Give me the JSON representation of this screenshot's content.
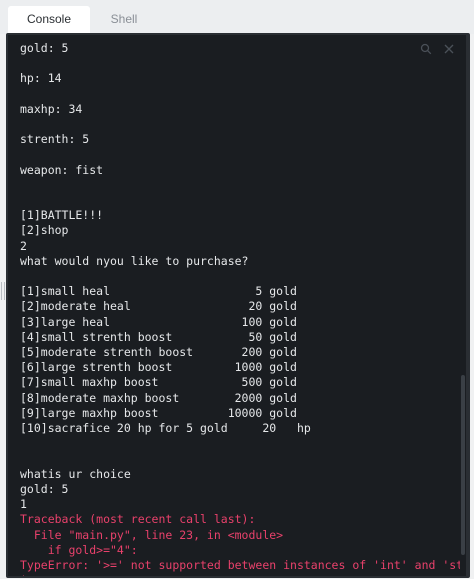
{
  "tabs": [
    {
      "label": "Console",
      "active": true
    },
    {
      "label": "Shell",
      "active": false
    }
  ],
  "toolbar": {
    "search_icon": "search-icon",
    "clear_icon": "close-icon"
  },
  "console": {
    "lines": [
      {
        "text": "gold: 5",
        "type": "out"
      },
      {
        "text": "",
        "type": "out"
      },
      {
        "text": "hp: 14",
        "type": "out"
      },
      {
        "text": "",
        "type": "out"
      },
      {
        "text": "maxhp: 34",
        "type": "out"
      },
      {
        "text": "",
        "type": "out"
      },
      {
        "text": "strenth: 5",
        "type": "out"
      },
      {
        "text": "",
        "type": "out"
      },
      {
        "text": "weapon: fist",
        "type": "out"
      },
      {
        "text": "",
        "type": "out"
      },
      {
        "text": "",
        "type": "out"
      },
      {
        "text": "[1]BATTLE!!!",
        "type": "out"
      },
      {
        "text": "[2]shop",
        "type": "out"
      },
      {
        "text": "2",
        "type": "out"
      },
      {
        "text": "what would nyou like to purchase?",
        "type": "out"
      },
      {
        "text": "",
        "type": "out"
      },
      {
        "text": "[1]small heal                     5 gold",
        "type": "out"
      },
      {
        "text": "[2]moderate heal                 20 gold",
        "type": "out"
      },
      {
        "text": "[3]large heal                   100 gold",
        "type": "out"
      },
      {
        "text": "[4]small strenth boost           50 gold",
        "type": "out"
      },
      {
        "text": "[5]moderate strenth boost       200 gold",
        "type": "out"
      },
      {
        "text": "[6]large strenth boost         1000 gold",
        "type": "out"
      },
      {
        "text": "[7]small maxhp boost            500 gold",
        "type": "out"
      },
      {
        "text": "[8]moderate maxhp boost        2000 gold",
        "type": "out"
      },
      {
        "text": "[9]large maxhp boost          10000 gold",
        "type": "out"
      },
      {
        "text": "[10]sacrafice 20 hp for 5 gold     20   hp",
        "type": "out"
      },
      {
        "text": "",
        "type": "out"
      },
      {
        "text": "",
        "type": "out"
      },
      {
        "text": "whatis ur choice",
        "type": "out"
      },
      {
        "text": "gold: 5",
        "type": "out"
      },
      {
        "text": "1",
        "type": "out"
      },
      {
        "text": "Traceback (most recent call last):",
        "type": "err"
      },
      {
        "text": "  File \"main.py\", line 23, in <module>",
        "type": "err"
      },
      {
        "text": "    if gold>=\"4\":",
        "type": "err"
      },
      {
        "text": "TypeError: '>=' not supported between instances of 'int' and 'str",
        "type": "err"
      },
      {
        "text": "'",
        "type": "err"
      }
    ],
    "prompt_symbol": "›"
  },
  "colors": {
    "terminal_bg": "#1a1d21",
    "output_text": "#e6e8ea",
    "error_text": "#e8416b",
    "prompt": "#f0a030"
  }
}
